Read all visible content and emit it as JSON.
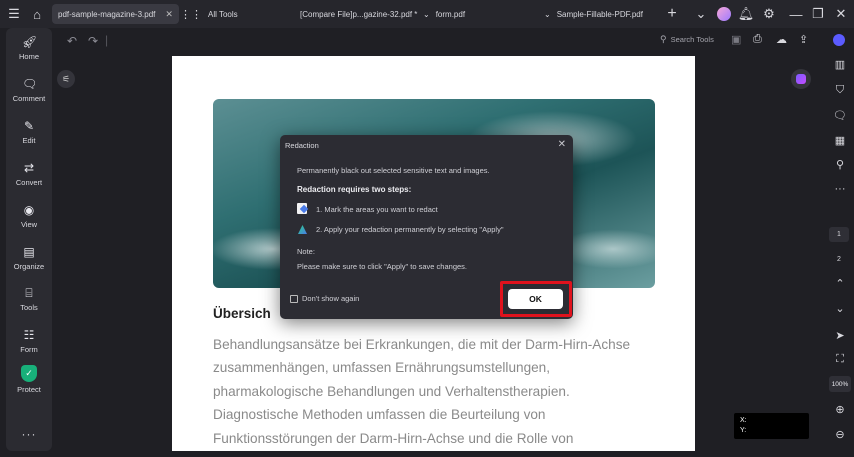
{
  "tabs": {
    "tab1": "pdf-sample-magazine-3.pdf",
    "all_tools": "All Tools",
    "tab2": "[Compare  File]p...gazine-32.pdf *",
    "tab3": "form.pdf",
    "tab4": "Sample-Fillable-PDF.pdf"
  },
  "sidebar": {
    "items": [
      {
        "label": "Home",
        "icon": "rocket-icon"
      },
      {
        "label": "Comment",
        "icon": "comment-icon"
      },
      {
        "label": "Edit",
        "icon": "edit-icon"
      },
      {
        "label": "Convert",
        "icon": "convert-icon"
      },
      {
        "label": "View",
        "icon": "eye-icon"
      },
      {
        "label": "Organize",
        "icon": "organize-icon"
      },
      {
        "label": "Tools",
        "icon": "toolbox-icon"
      },
      {
        "label": "Form",
        "icon": "form-icon"
      },
      {
        "label": "Protect",
        "icon": "shield-icon"
      }
    ],
    "more": "···"
  },
  "toolbar": {
    "search_label": "Search Tools"
  },
  "page": {
    "heading": "Übersich",
    "body_lines": [
      "Behandlungsansätze bei Erkrankungen, die mit der Darm-Hirn-Achse",
      "zusammenhängen, umfassen Ernährungsumstellungen,",
      "pharmakologische Behandlungen und Verhaltenstherapien.",
      "Diagnostische Methoden umfassen die Beurteilung von",
      "Funktionsstörungen der Darm-Hirn-Achse und die Rolle von"
    ]
  },
  "dialog": {
    "title": "Redaction",
    "intro": "Permanently black out selected sensitive text and images.",
    "steps_heading": "Redaction requires two steps:",
    "step1": "1. Mark the areas you want to redact",
    "step2": "2. Apply your redaction permanently by selecting \"Apply\"",
    "note_label": "Note:",
    "note_text": "Please make sure to click \"Apply\" to save changes.",
    "dont_show": "Don't show again",
    "ok": "OK"
  },
  "right_panel": {
    "page_numbers": [
      "1",
      "2"
    ],
    "zoom": "100%"
  },
  "coords": {
    "x_label": "X:",
    "y_label": "Y:"
  },
  "colors": {
    "highlight": "#e0121d",
    "accent": "#7b5cff"
  }
}
